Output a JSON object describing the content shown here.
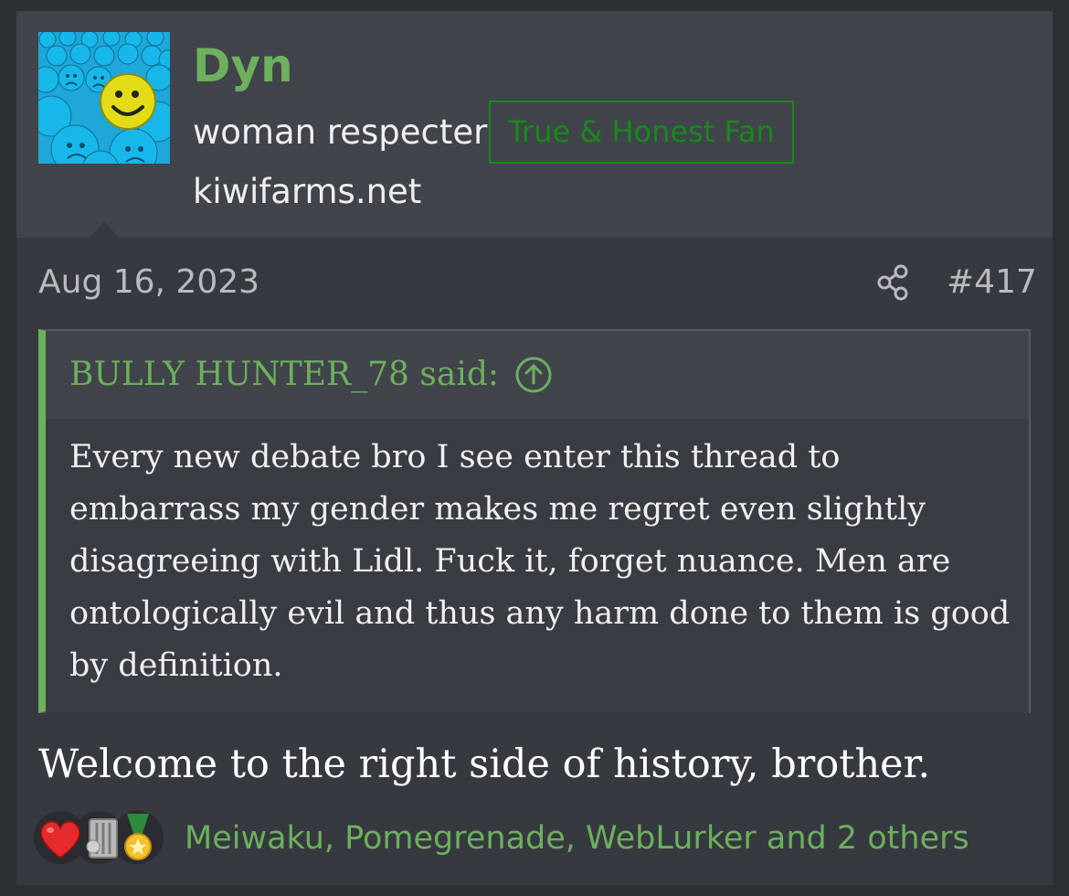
{
  "user": {
    "name": "Dyn",
    "title": "woman respecter",
    "banner": "True & Honest Fan",
    "site": "kiwifarms.net"
  },
  "post": {
    "date": "Aug 16, 2023",
    "number": "#417",
    "message": "Welcome to the right side of history, brother."
  },
  "quote": {
    "attribution": "BULLY HUNTER_78 said:",
    "text": "Every new debate bro I see enter this thread to embarrass my gender makes me regret even slightly disagreeing with Lidl. Fuck it, forget nuance. Men are ontologically evil and thus any harm done to them is good by definition."
  },
  "reactions": {
    "icons": [
      "heart-icon",
      "trash-can-icon",
      "gold-medal-icon"
    ],
    "users": "Meiwaku, Pomegrenade, WebLurker and 2 others"
  },
  "colors": {
    "accent": "#6db05d",
    "banner": "#178a1a",
    "background": "#36393f"
  }
}
